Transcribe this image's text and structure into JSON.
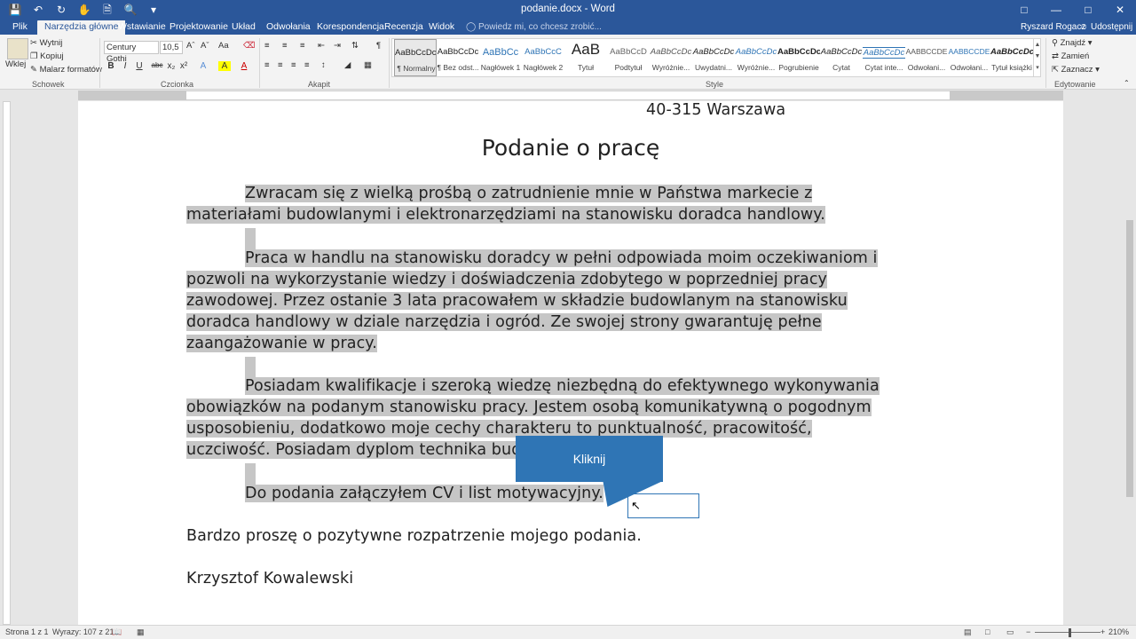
{
  "app": {
    "title": "podanie.docx - Word",
    "colors": {
      "brand": "#2b579a",
      "callout": "#2f75b5",
      "highlight": "#c6c6c6"
    }
  },
  "qat": {
    "icons": [
      "save-icon",
      "undo-icon",
      "redo-icon",
      "touch-mode-icon",
      "new-icon",
      "print-preview-icon",
      "customize-icon"
    ]
  },
  "window_controls": [
    "ribbon-display-icon",
    "minimize-icon",
    "maximize-icon",
    "close-icon"
  ],
  "tabs": [
    {
      "label": "Plik"
    },
    {
      "label": "Narzędzia główne"
    },
    {
      "label": "Wstawianie"
    },
    {
      "label": "Projektowanie"
    },
    {
      "label": "Układ"
    },
    {
      "label": "Odwołania"
    },
    {
      "label": "Korespondencja"
    },
    {
      "label": "Recenzja"
    },
    {
      "label": "Widok"
    }
  ],
  "tell_me": "Powiedz mi, co chcesz zrobić...",
  "user": "Ryszard Rogacz",
  "share": "Udostępnij",
  "clipboard": {
    "paste": "Wklej",
    "cut": "Wytnij",
    "copy": "Kopiuj",
    "format_painter": "Malarz formatów",
    "group": "Schowek"
  },
  "font": {
    "family": "Century Gothi",
    "size": "10,5",
    "group": "Czcionka",
    "buttons": [
      "B",
      "I",
      "U",
      "abc",
      "x₂",
      "x²",
      "A",
      "A",
      "A"
    ]
  },
  "paragraph": {
    "group": "Akapit"
  },
  "styles": {
    "group": "Style",
    "items": [
      {
        "preview": "AaBbCcDc",
        "name": "¶ Normalny"
      },
      {
        "preview": "AaBbCcDc",
        "name": "¶ Bez odst..."
      },
      {
        "preview": "AaBbCc",
        "name": "Nagłówek 1"
      },
      {
        "preview": "AaBbCcC",
        "name": "Nagłówek 2"
      },
      {
        "preview": "AaB",
        "name": "Tytuł"
      },
      {
        "preview": "AaBbCcD",
        "name": "Podtytuł"
      },
      {
        "preview": "AaBbCcDc",
        "name": "Wyróżnie..."
      },
      {
        "preview": "AaBbCcDc",
        "name": "Uwydatni..."
      },
      {
        "preview": "AaBbCcDc",
        "name": "Wyróżnie..."
      },
      {
        "preview": "AaBbCcDc",
        "name": "Pogrubienie"
      },
      {
        "preview": "AaBbCcDc",
        "name": "Cytat"
      },
      {
        "preview": "AaBbCcDc",
        "name": "Cytat inte..."
      },
      {
        "preview": "AABBCCDE",
        "name": "Odwołani..."
      },
      {
        "preview": "AABBCCDE",
        "name": "Odwołani..."
      },
      {
        "preview": "AaBbCcDc",
        "name": "Tytuł książki"
      }
    ]
  },
  "editing": {
    "find": "Znajdź",
    "replace": "Zamień",
    "select": "Zaznacz",
    "group": "Edytowanie"
  },
  "document": {
    "address": "40-315 Warszawa",
    "title": "Podanie o pracę",
    "p1": [
      "Zwracam się z wielką prośbą o zatrudnienie mnie w Państwa markecie z",
      "materiałami budowlanymi i elektronarzędziami na stanowisku doradca handlowy."
    ],
    "p2": [
      "Praca w handlu na stanowisku doradcy w pełni odpowiada moim oczekiwaniom i",
      "pozwoli na wykorzystanie wiedzy i doświadczenia zdobytego w poprzedniej pracy",
      "zawodowej. Przez ostanie 3 lata pracowałem w składzie budowlanym na stanowisku",
      "doradca handlowy w dziale narzędzia i ogród. Ze swojej strony gwarantuję pełne",
      "zaangażowanie w pracy."
    ],
    "p3": [
      "Posiadam kwalifikacje i szeroką wiedzę niezbędną do efektywnego wykonywania",
      "obowiązków na podanym stanowisku pracy. Jestem osobą komunikatywną o pogodnym",
      "usposobieniu, dodatkowo moje cechy charakteru to punktualność, pracowitość,",
      "uczciwość. Posiadam dyplom technika budowlanego."
    ],
    "p4": "Do podania załączyłem CV i list motywacyjny.",
    "p5": "Bardzo proszę o pozytywne rozpatrzenie mojego podania.",
    "signature": "Krzysztof Kowalewski"
  },
  "callout": {
    "label": "Kliknij"
  },
  "status": {
    "page": "Strona 1 z 1",
    "words": "Wyrazy: 107 z 212",
    "zoom": "210%"
  }
}
